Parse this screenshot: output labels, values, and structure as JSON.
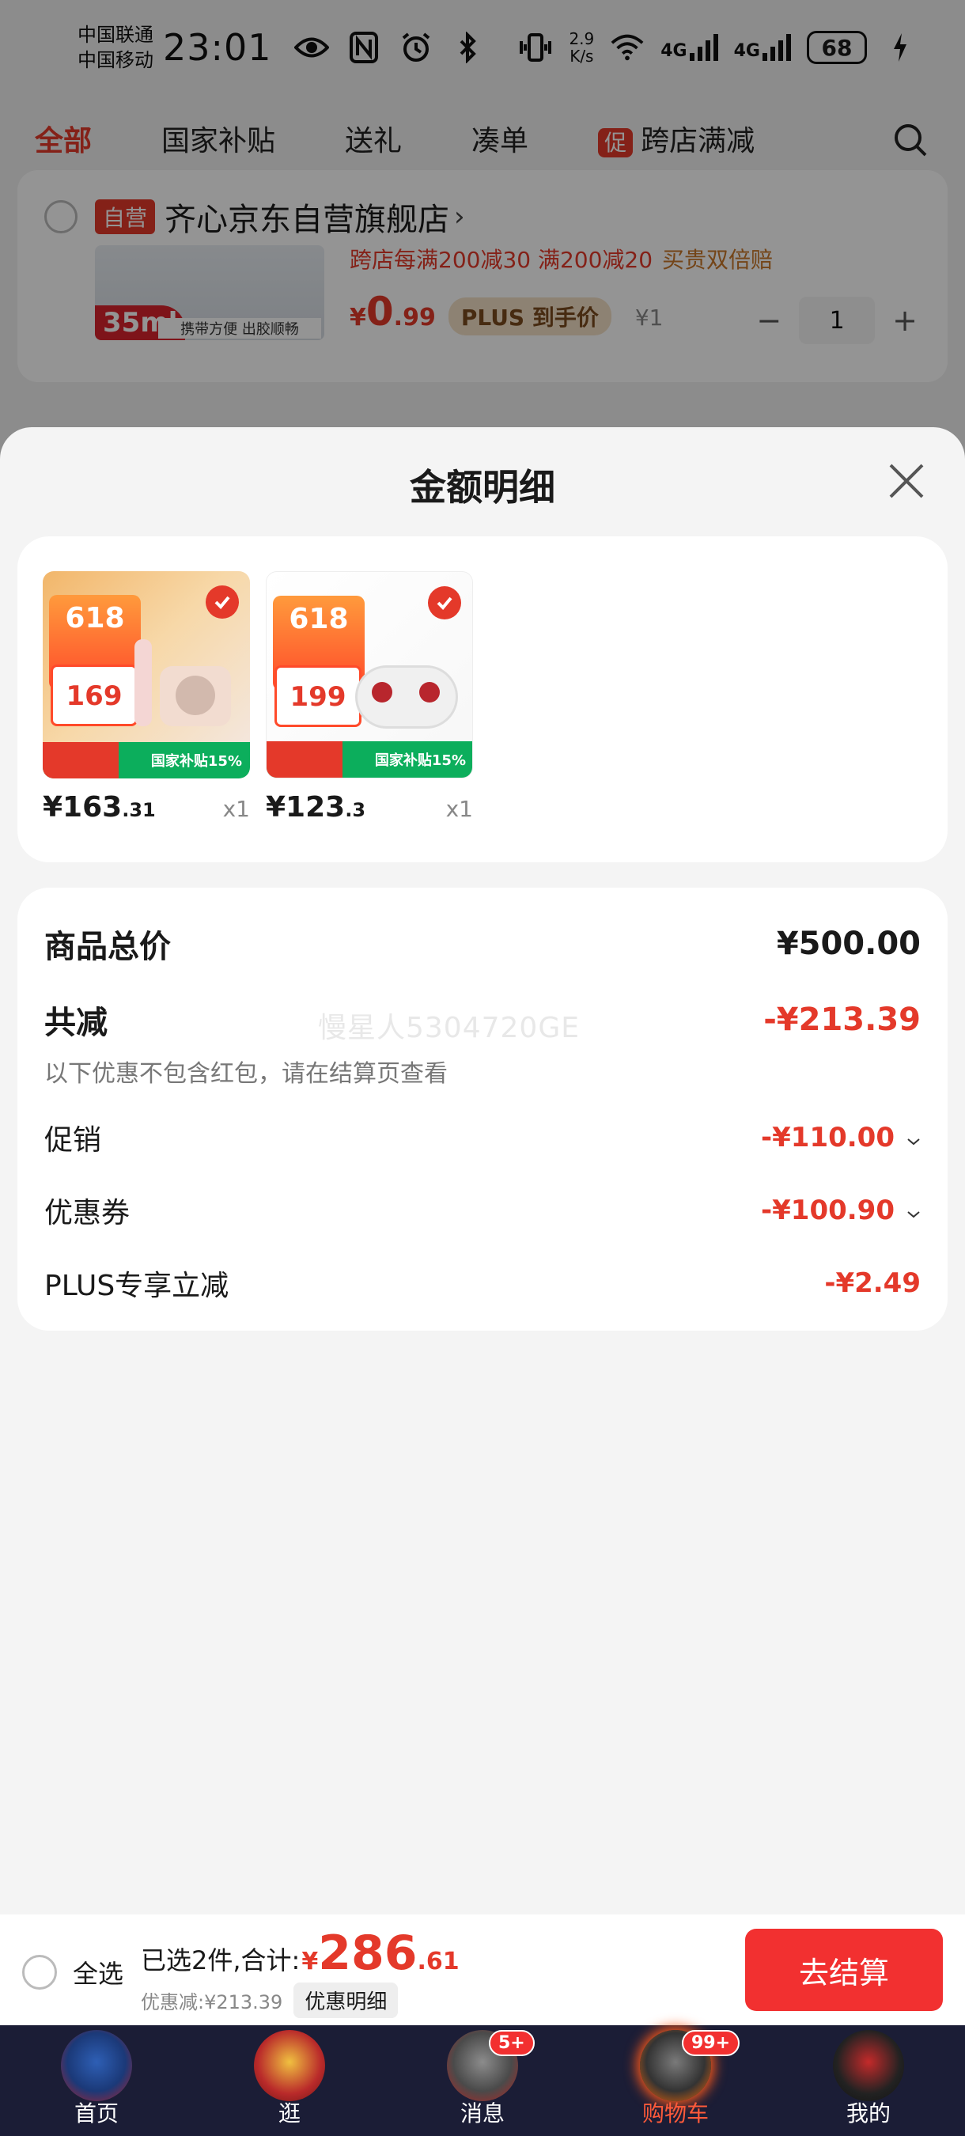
{
  "status_bar": {
    "carrier1": "中国联通",
    "carrier2": "中国移动",
    "time": "23:01",
    "net_speed_value": "2.9",
    "net_speed_unit": "K/s",
    "signal1": "4G",
    "signal2": "4G",
    "battery": "68"
  },
  "top_tabs": {
    "all": "全部",
    "subsidy": "国家补贴",
    "gift": "送礼",
    "bundle": "凑单",
    "promo_tag": "促",
    "cross_store": "跨店满减"
  },
  "background_store": {
    "tag": "自营",
    "name": "齐心京东自营旗舰店",
    "arrow": "›",
    "promo_text": "跨店每满200减30  满200减20",
    "promo_gold": "买贵双倍赔",
    "thumb_ml": "35ml",
    "thumb_slogan": "携带方便 出胶顺畅",
    "price_int": "0",
    "price_dec": ".99",
    "currency": "¥",
    "plus_chip": "PLUS 到手价",
    "orig_price": "¥1",
    "qty_minus": "−",
    "qty": "1",
    "qty_plus": "+"
  },
  "sheet": {
    "title": "金额明细",
    "items": [
      {
        "price_int": "¥163",
        "price_dec": ".31",
        "qty": "x1",
        "badge": "618",
        "tag_price": "169",
        "band": "国家补贴15%"
      },
      {
        "price_int": "¥123",
        "price_dec": ".3",
        "qty": "x1",
        "badge": "618",
        "tag_price": "199",
        "band": "国家补贴15%"
      }
    ],
    "summary": {
      "total_label": "商品总价",
      "total_value": "¥500.00",
      "discount_label": "共减",
      "discount_value": "-¥213.39",
      "note": "以下优惠不包含红包，请在结算页查看",
      "watermark": "慢星人5304720GE",
      "promo_label": "促销",
      "promo_value": "-¥110.00",
      "coupon_label": "优惠券",
      "coupon_value": "-¥100.90",
      "plus_label": "PLUS专享立减",
      "plus_value": "-¥2.49"
    }
  },
  "checkout": {
    "select_all": "全选",
    "selected_text": "已选2件,合计:",
    "currency": "¥",
    "total_int": "286",
    "total_dec": ".61",
    "discount_text": "优惠减:¥213.39",
    "detail_chip": "优惠明细",
    "button": "去结算"
  },
  "bottom_nav": {
    "items": [
      {
        "label": "首页",
        "badge": ""
      },
      {
        "label": "逛",
        "badge": ""
      },
      {
        "label": "消息",
        "badge": "5+"
      },
      {
        "label": "购物车",
        "badge": "99+"
      },
      {
        "label": "我的",
        "badge": ""
      }
    ]
  },
  "colors": {
    "accent_red": "#e4392a",
    "checkout_red": "#f23030",
    "nav_bg": "#1b1d36"
  }
}
